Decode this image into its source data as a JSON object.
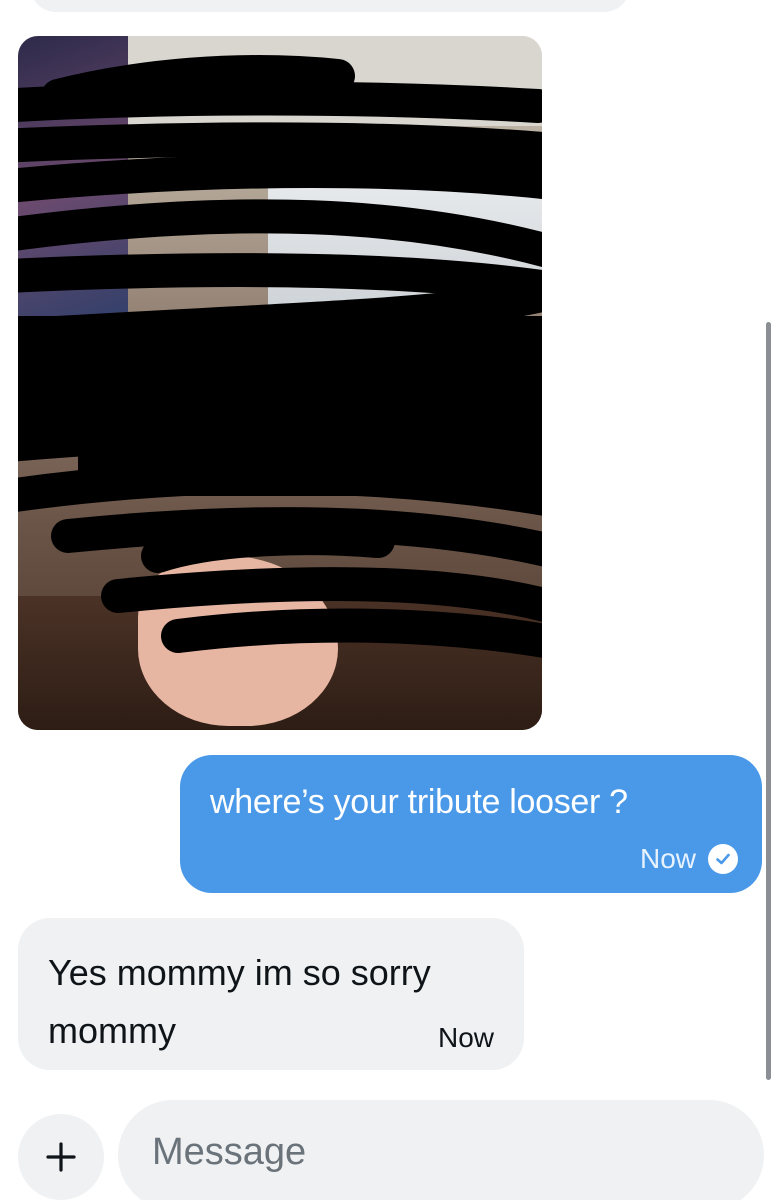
{
  "thread": {
    "image_message": {
      "media_icon": "photo",
      "redacted": true
    },
    "outgoing": {
      "text": "where’s your tribute looser ?",
      "time": "Now",
      "status_icon": "check-circle-icon"
    },
    "incoming": {
      "text": "Yes mommy im so sorry mommy",
      "time": "Now"
    }
  },
  "composer": {
    "add_icon": "plus-icon",
    "placeholder": "Message"
  },
  "colors": {
    "outgoing_bubble": "#4a99e9",
    "incoming_bubble": "#eff1f3",
    "text": "#0f1419"
  }
}
